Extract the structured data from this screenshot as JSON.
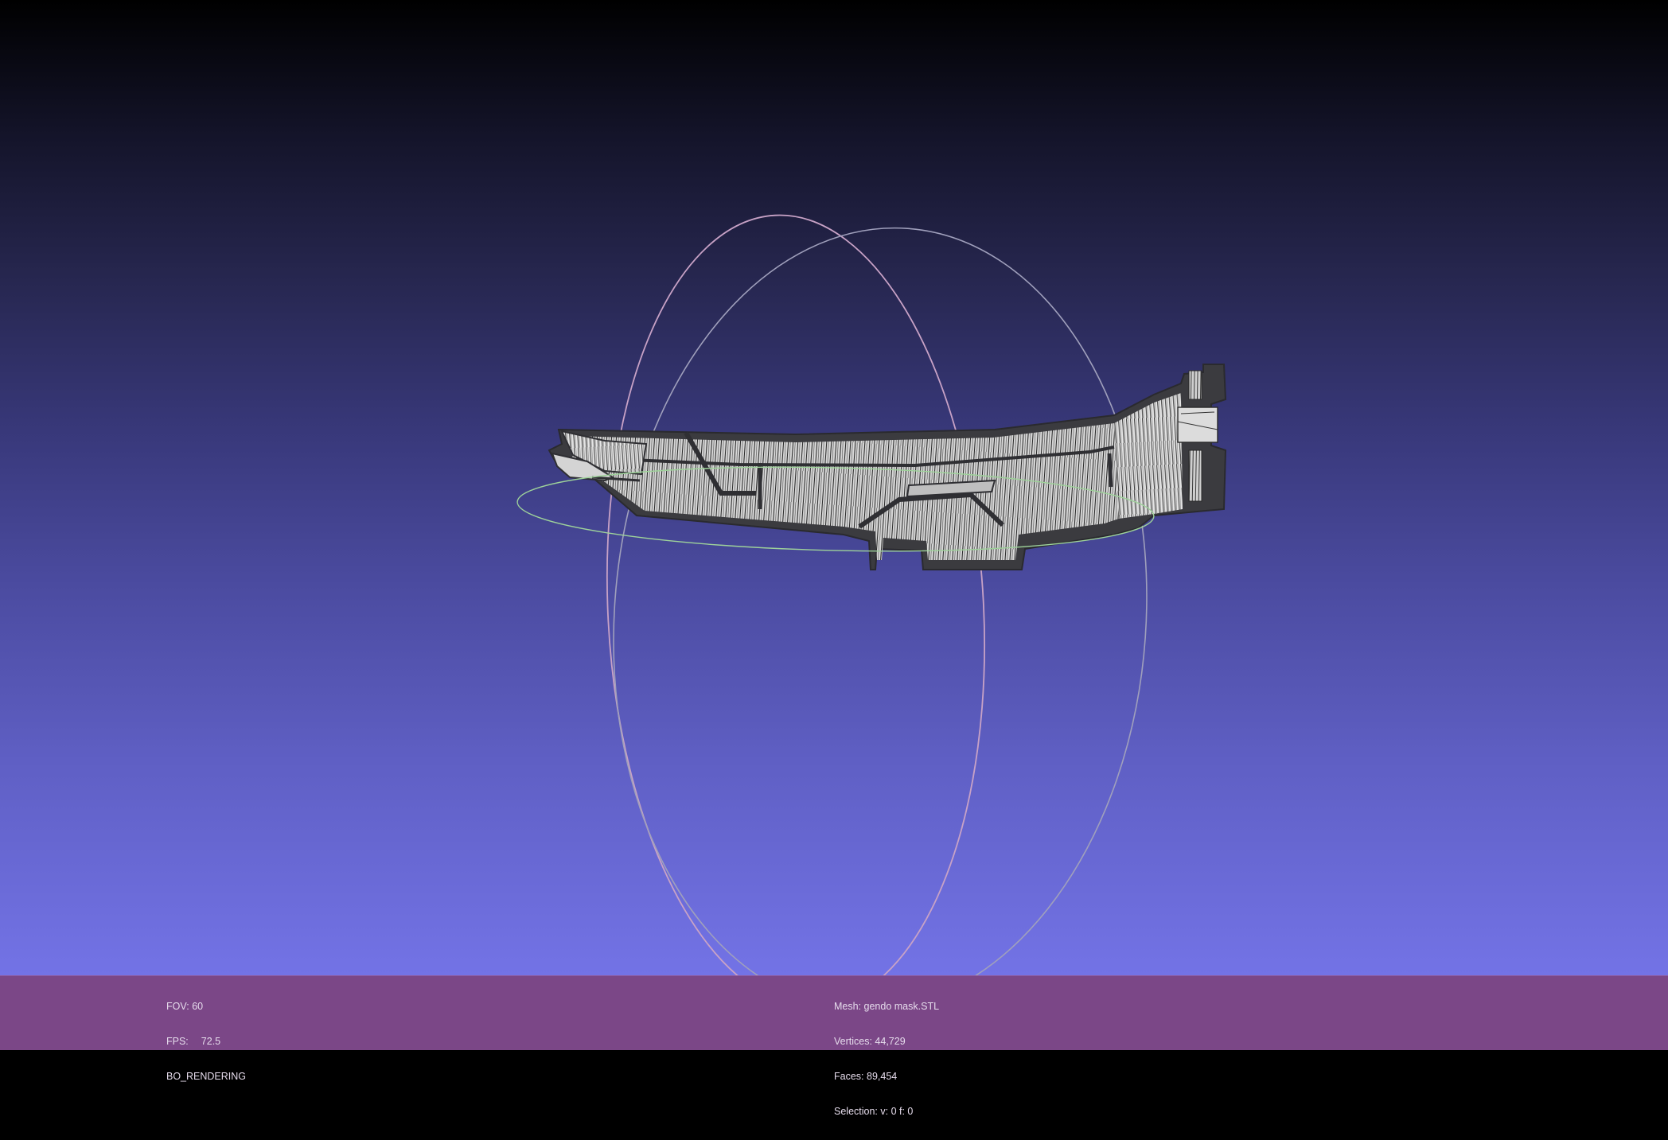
{
  "viewer": {
    "title": "",
    "background_top": "#000000",
    "background_bottom": "#7373e6",
    "status_bar_color": "#7b4787"
  },
  "left_info": {
    "fov_label": "FOV:",
    "fov_value": "60",
    "fps_label": "FPS:",
    "fps_value": "72.5",
    "render_mode": "BO_RENDERING"
  },
  "right_info": {
    "mesh_label": "Mesh:",
    "mesh_value": "gendo mask.STL",
    "vertices_label": "Vertices:",
    "vertices_value": "44,729",
    "faces_label": "Faces:",
    "faces_value": "89,454",
    "selection_label": "Selection:",
    "selection_value": "v: 0 f: 0"
  },
  "scene": {
    "model_name": "gendo mask",
    "trackball": "arcball-icon"
  }
}
